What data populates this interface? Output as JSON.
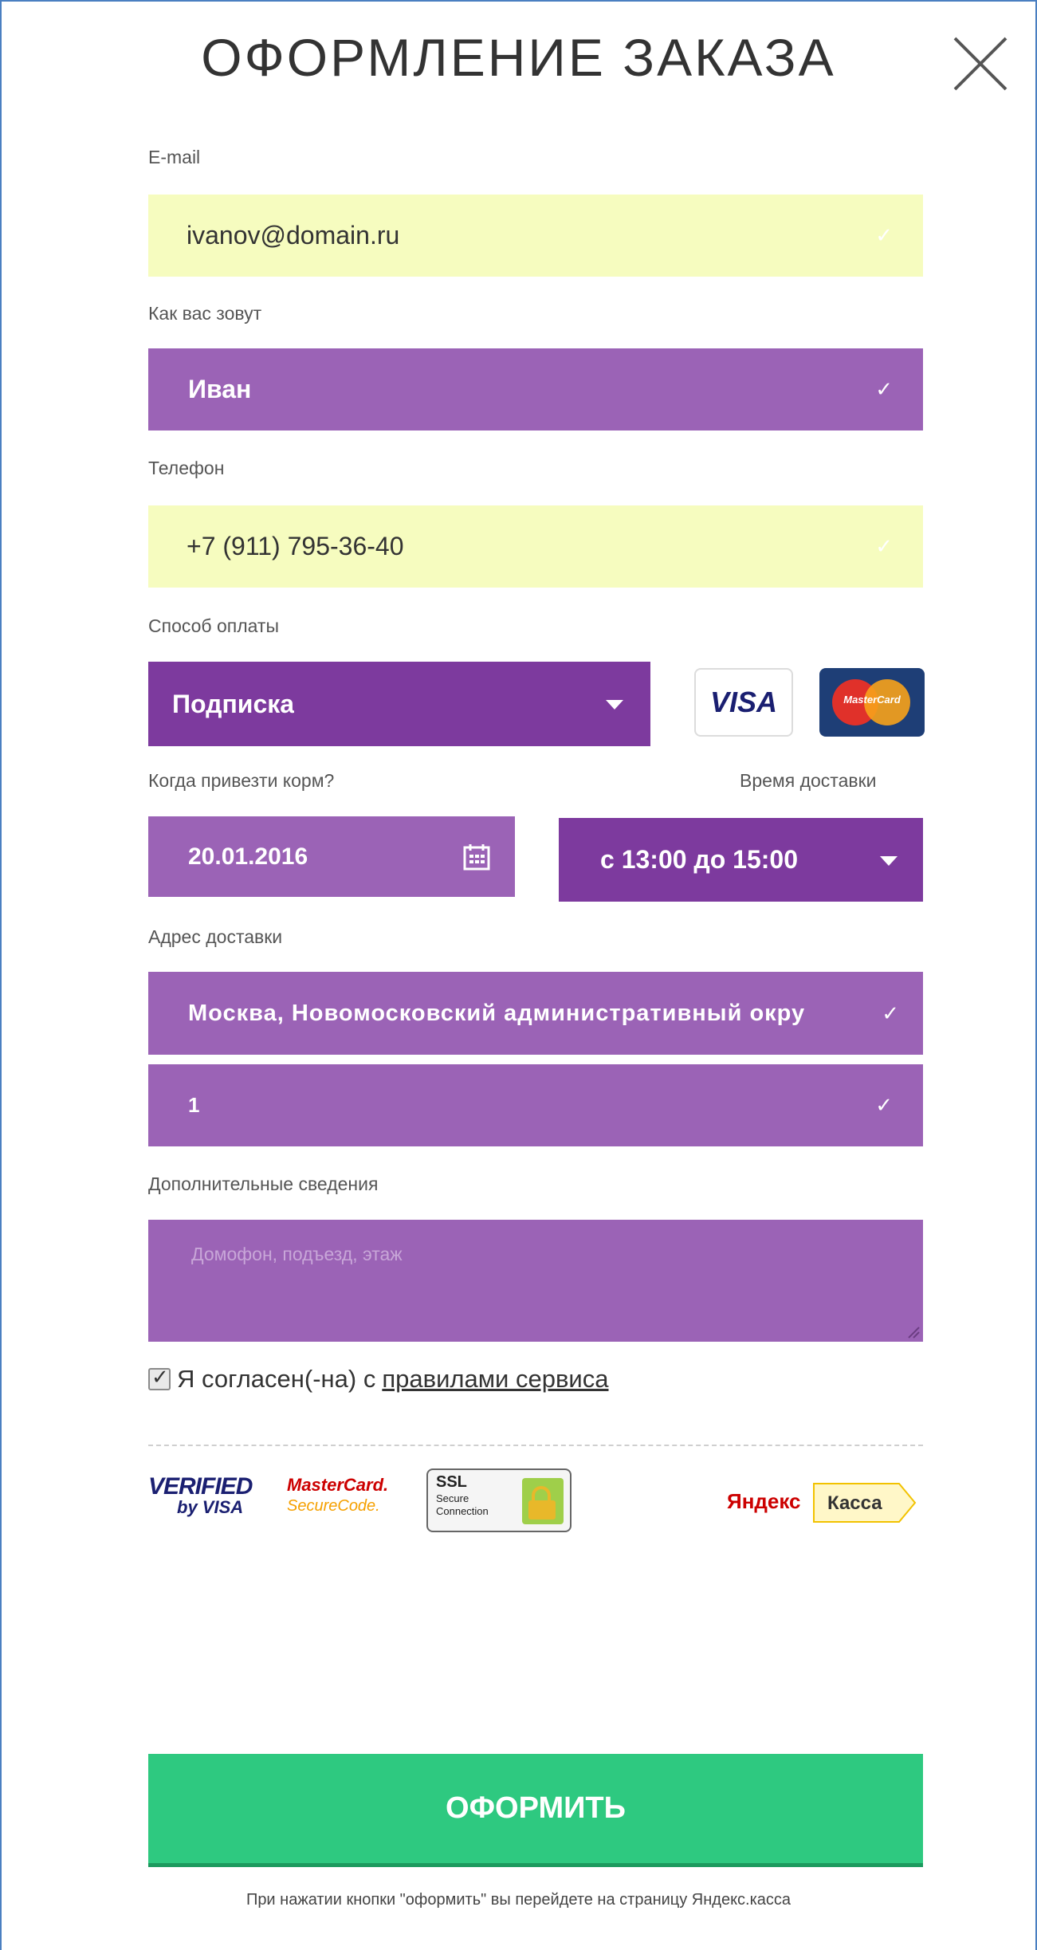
{
  "title": "ОФОРМЛЕНИЕ ЗАКАЗА",
  "fields": {
    "email": {
      "label": "E-mail",
      "value": "ivanov@domain.ru"
    },
    "name": {
      "label": "Как вас зовут",
      "value": "Иван"
    },
    "phone": {
      "label": "Телефон",
      "value": "+7 (911) 795-36-40"
    },
    "payment": {
      "label": "Способ оплаты",
      "value": "Подписка"
    },
    "date": {
      "label": "Когда привезти корм?",
      "value": "20.01.2016"
    },
    "time": {
      "label": "Время доставки",
      "value": "с 13:00 до 15:00"
    },
    "address": {
      "label": "Адрес доставки",
      "value": "Москва, Новомосковский административный окру",
      "extra": "1"
    },
    "notes": {
      "label": "Дополнительные сведения",
      "placeholder": "Домофон, подъезд, этаж"
    }
  },
  "agreement": {
    "text": "Я согласен(-на) с ",
    "link": "правилами сервиса"
  },
  "badges": {
    "visa": "VISA",
    "mastercard": "MasterCard",
    "verified_line1": "VERIFIED",
    "verified_line2": "by VISA",
    "mc_secure_line1": "MasterCard.",
    "mc_secure_line2": "SecureCode.",
    "ssl_line1": "SSL",
    "ssl_line2": "Secure",
    "ssl_line3": "Connection",
    "yandex": "Яндекс",
    "kassa": "Касса"
  },
  "submit_label": "ОФОРМИТЬ",
  "footnote": "При нажатии кнопки \"оформить\" вы перейдете на страницу Яндекс.касса",
  "colors": {
    "field_valid": "#9b63b6",
    "field_dark": "#7d3a9e",
    "field_yellow": "#f6fcbf",
    "submit": "#2ec980"
  }
}
